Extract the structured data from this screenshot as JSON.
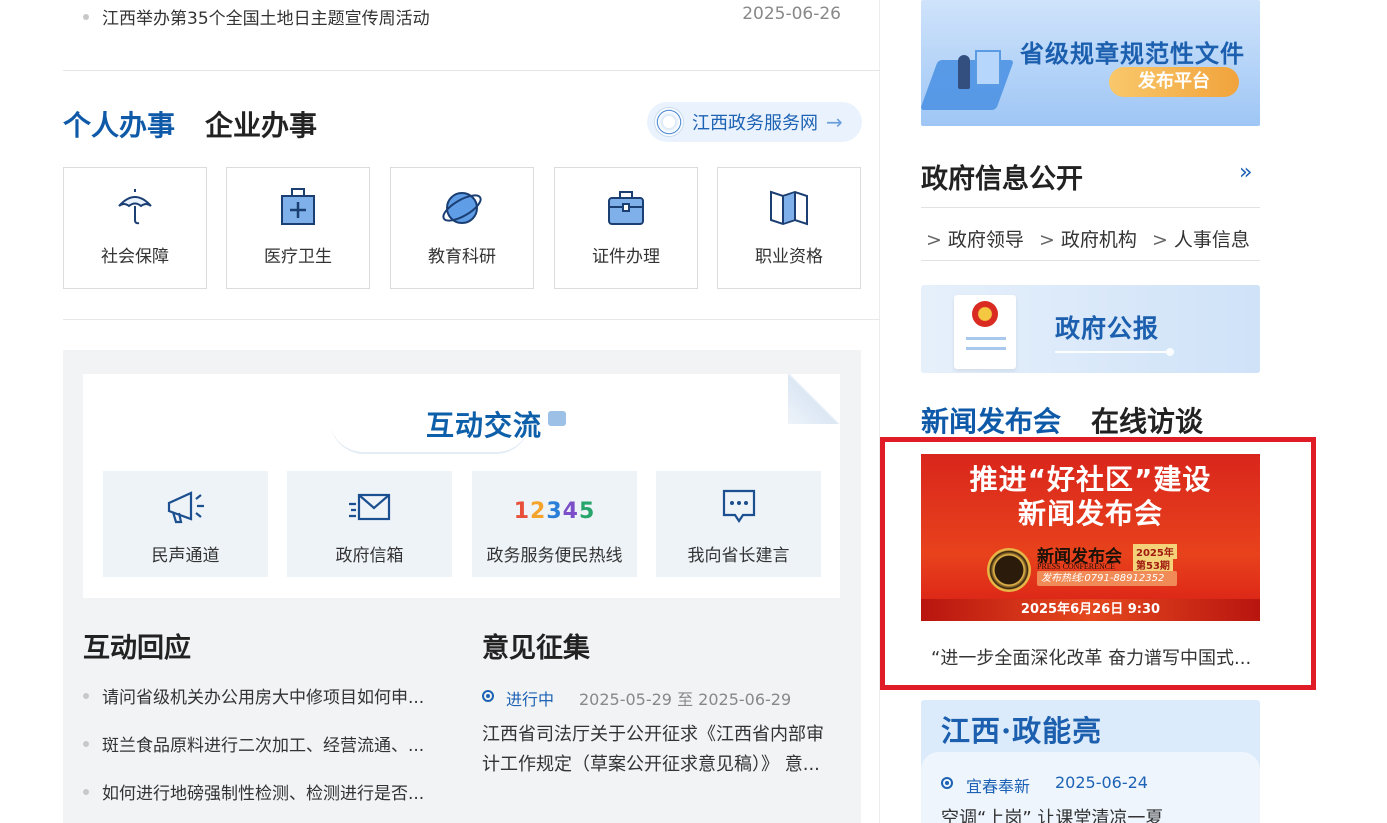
{
  "news": {
    "title": "江西举办第35个全国土地日主题宣传周活动",
    "date": "2025-06-26"
  },
  "services": {
    "tabs": [
      "个人办事",
      "企业办事"
    ],
    "portal_label": "江西政务服务网",
    "portal_arrow": "→",
    "items": [
      {
        "label": "社会保障",
        "icon": "umbrella-icon"
      },
      {
        "label": "医疗卫生",
        "icon": "medical-kit-icon"
      },
      {
        "label": "教育科研",
        "icon": "planet-icon"
      },
      {
        "label": "证件办理",
        "icon": "briefcase-icon"
      },
      {
        "label": "职业资格",
        "icon": "book-icon"
      }
    ]
  },
  "interaction": {
    "title": "互动交流",
    "tiles": [
      {
        "label": "民声通道",
        "icon": "megaphone-icon"
      },
      {
        "label": "政府信箱",
        "icon": "envelope-icon"
      },
      {
        "label": "政务服务便民热线",
        "icon": "hotline-12345-icon",
        "number": "12345"
      },
      {
        "label": "我向省长建言",
        "icon": "chat-bubble-icon"
      }
    ]
  },
  "responses": {
    "title": "互动回应",
    "items": [
      "请问省级机关办公用房大中修项目如何申...",
      "斑兰食品原料进行二次加工、经营流通、...",
      "如何进行地磅强制性检测、检测进行是否..."
    ]
  },
  "opinions": {
    "title": "意见征集",
    "status": "进行中",
    "date_range": "2025-05-29 至 2025-06-29",
    "text": "江西省司法厅关于公开征求《江西省内部审计工作规定（草案公开征求意见稿）》 意..."
  },
  "sidebar": {
    "rules_banner": {
      "title": "省级规章规范性文件",
      "pill": "发布平台"
    },
    "gov_info": {
      "title": "政府信息公开",
      "more": "»",
      "links": [
        "政府领导",
        "政府机构",
        "人事信息"
      ]
    },
    "bulletin_banner": {
      "title": "政府公报"
    },
    "press": {
      "tabs": [
        "新闻发布会",
        "在线访谈"
      ],
      "banner_line1": "推进“好社区”建设",
      "banner_line2": "新闻发布会",
      "banner_logo_cn": "新闻发布会",
      "banner_logo_en": "PRESS CONFERENCE",
      "banner_year": "2025年",
      "banner_issue": "第53期",
      "banner_hotline": "发布热线:0791-88912352",
      "banner_time": "2025年6月26日  9:30",
      "caption": "“进一步全面深化改革 奋力谱写中国式..."
    },
    "energy": {
      "title": "江西·政能亮",
      "tag": "宜春奉新",
      "date": "2025-06-24",
      "text": "空调“上岗” 让课堂清凉一夏"
    }
  },
  "colors": {
    "brand_blue": "#0e5aa8",
    "highlight_red": "#e01c26"
  }
}
